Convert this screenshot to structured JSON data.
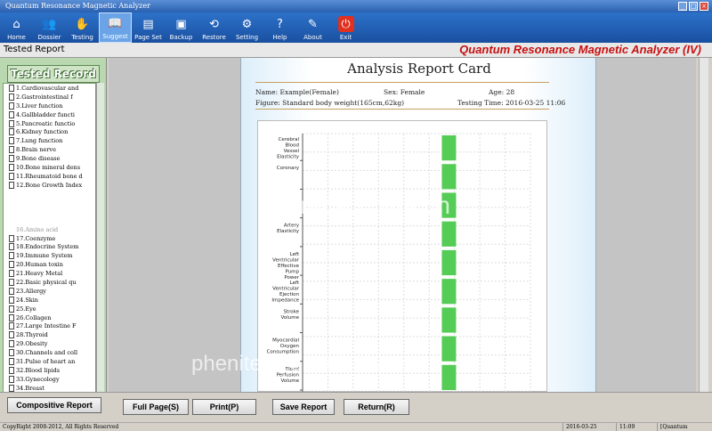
{
  "window": {
    "title": "Quantum Resonance Magnetic Analyzer"
  },
  "toolbar": {
    "buttons": [
      {
        "label": "Home",
        "icon": "home-icon"
      },
      {
        "label": "Dossier",
        "icon": "people-icon"
      },
      {
        "label": "Testing",
        "icon": "hand-icon"
      },
      {
        "label": "Suggest",
        "icon": "book-icon"
      },
      {
        "label": "Page Set",
        "icon": "page-setup-icon"
      },
      {
        "label": "Backup",
        "icon": "disk-icon"
      },
      {
        "label": "Restore",
        "icon": "restore-icon"
      },
      {
        "label": "Setting",
        "icon": "gear-icon"
      },
      {
        "label": "Help",
        "icon": "help-icon"
      },
      {
        "label": "About",
        "icon": "about-icon"
      },
      {
        "label": "Exit",
        "icon": "exit-icon"
      }
    ],
    "active_index": 3
  },
  "subheader": {
    "left_label": "Tested Report",
    "brand": "Quantum Resonance Magnetic Analyzer (IV)"
  },
  "left_panel": {
    "title": "Tested Record",
    "items_top": [
      "1.Cardiovascular and",
      "2.Gastrointestinal f",
      "3.Liver function",
      "4.Gallbladder functi",
      "5.Pancreatic functio",
      "6.Kidney function",
      "7.Lung function",
      "8.Brain nerve",
      "9.Bone disease",
      "10.Bone mineral dens",
      "11.Rheumatoid bone d",
      "12.Bone Growth Index"
    ],
    "items_partial": "16.Amino acid",
    "items_bottom": [
      "17.Coenzyme",
      "18.Endocrine System",
      "19.Immune System",
      "20.Human toxin",
      "21.Heavy Metal",
      "22.Basic physical qu",
      "23.Allergy",
      "24.Skin",
      "25.Eye",
      "26.Collagen",
      "27.Large Intestine F",
      "28.Thyroid",
      "29.Obesity",
      "30.Channels and coll",
      "31.Pulse of heart an",
      "32.Blood lipids",
      "33.Gynecology",
      "34.Breast"
    ],
    "button_label": "Compositive Report"
  },
  "report": {
    "title": "Analysis Report Card",
    "name": "Name: Example(Female)",
    "sex": "Sex: Female",
    "age": "Age: 28",
    "figure": "Figure: Standard body weight(165cm,62kg)",
    "testing_time": "Testing Time: 2016-03-25 11:06"
  },
  "chart_data": {
    "type": "bar",
    "orientation": "horizontal",
    "categories": [
      "Cerebral Blood Vessel Elasticity",
      "Coronary",
      "",
      "Artery Elasticity",
      "Left Ventricular Effective Pump Power",
      "Left Ventricular Ejection Impedance",
      "Stroke Volume",
      "Myocardial Oxygen Consumption",
      "Blood Perfusion Volume"
    ],
    "bar_color": "#55cc55",
    "grid": true
  },
  "bottom_buttons": {
    "full_page": "Full Page(S)",
    "print": "Print(P)",
    "save_report": "Save Report",
    "return": "Return(R)"
  },
  "status": {
    "copyright": "CopyRight 2008-2012, All Rights Reserved",
    "date": "2016-03-25",
    "time": "11:09",
    "company": "[Quantum Software]"
  },
  "watermarks": [
    "trade.china.cn",
    "phenitech.en.alibaba.com"
  ]
}
